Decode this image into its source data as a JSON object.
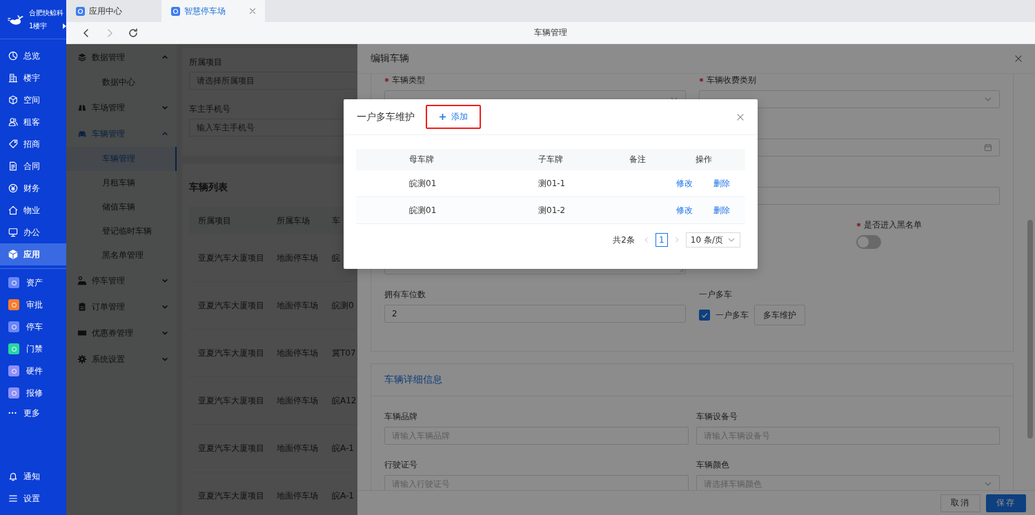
{
  "app": {
    "company": "合肥快鲸科",
    "building": "1楼宇"
  },
  "nav": {
    "items": [
      {
        "label": "总览",
        "selected": false
      },
      {
        "label": "楼宇",
        "selected": false
      },
      {
        "label": "空间",
        "selected": false
      },
      {
        "label": "租客",
        "selected": false
      },
      {
        "label": "招商",
        "selected": false
      },
      {
        "label": "合同",
        "selected": false
      },
      {
        "label": "财务",
        "selected": false
      },
      {
        "label": "物业",
        "selected": false
      },
      {
        "label": "办公",
        "selected": false
      },
      {
        "label": "应用",
        "selected": true
      }
    ],
    "apps": [
      {
        "label": "资产",
        "color": "#6b86f7"
      },
      {
        "label": "审批",
        "color": "#fb7d2a"
      },
      {
        "label": "停车",
        "color": "#6b86f7"
      },
      {
        "label": "门禁",
        "color": "#26d6a3"
      },
      {
        "label": "硬件",
        "color": "#8f8ff7"
      },
      {
        "label": "报修",
        "color": "#8f8ff7"
      }
    ],
    "more": "更多",
    "bottom": [
      "通知",
      "设置"
    ]
  },
  "tabs": [
    {
      "label": "应用中心",
      "selected": false,
      "closable": false
    },
    {
      "label": "智慧停车场",
      "selected": true,
      "closable": true
    }
  ],
  "toolbar": {
    "title": "车辆管理",
    "buttons": [
      {
        "kind": "back",
        "disabled": false
      },
      {
        "kind": "forward",
        "disabled": true
      },
      {
        "kind": "reload",
        "disabled": false
      }
    ]
  },
  "submenu": [
    {
      "label": "数据管理",
      "expanded": true,
      "selected": false,
      "children": [
        {
          "label": "数据中心",
          "selected": false
        }
      ]
    },
    {
      "label": "车场管理",
      "expanded": false,
      "selected": false
    },
    {
      "label": "车辆管理",
      "expanded": true,
      "selected": true,
      "children": [
        {
          "label": "车辆管理",
          "selected": true
        },
        {
          "label": "月租车辆",
          "selected": false
        },
        {
          "label": "储值车辆",
          "selected": false
        },
        {
          "label": "登记临时车辆",
          "selected": false
        },
        {
          "label": "黑名单管理",
          "selected": false
        }
      ]
    },
    {
      "label": "停车管理",
      "expanded": false,
      "selected": false
    },
    {
      "label": "订单管理",
      "expanded": false,
      "selected": false
    },
    {
      "label": "优惠券管理",
      "expanded": false,
      "selected": false
    },
    {
      "label": "系统设置",
      "expanded": false,
      "selected": false
    }
  ],
  "filters": [
    {
      "label": "所属项目",
      "placeholder": "请选择所属项目"
    },
    {
      "label": "车主手机号",
      "placeholder": "输入车主手机号"
    }
  ],
  "vehicle_list": {
    "title": "车辆列表",
    "columns": [
      "所属项目",
      "所属车场",
      "车"
    ],
    "rows": [
      [
        "亚夏汽车大厦项目",
        "地面停车场",
        "皖"
      ],
      [
        "亚夏汽车大厦项目",
        "地面停车场",
        "皖测0"
      ],
      [
        "亚夏汽车大厦项目",
        "地面停车场",
        "冀T07"
      ],
      [
        "亚夏汽车大厦项目",
        "地面停车场",
        "皖A12"
      ],
      [
        "亚夏汽车大厦项目",
        "地面停车场",
        "皖A-1"
      ],
      [
        "亚夏汽车大厦项目",
        "地面停车场",
        "皖A-1"
      ]
    ]
  },
  "drawer": {
    "title": "编辑车辆",
    "fields": [
      {
        "kind": "select",
        "label": "车辆类型",
        "required": true
      },
      {
        "kind": "select",
        "label": "车辆收费类别",
        "required": true
      },
      {
        "kind": "covered"
      },
      {
        "kind": "date"
      },
      {
        "kind": "covered"
      },
      {
        "kind": "input"
      },
      {
        "kind": "textarea"
      },
      {
        "kind": "switch",
        "label": "是否进入黑名单",
        "required": true,
        "on": false
      },
      {
        "kind": "input",
        "label": "拥有车位数",
        "value": "2"
      },
      {
        "kind": "checkbox",
        "label": "一户多车",
        "option": "一户多车",
        "checked": true,
        "button": "多车维护"
      }
    ],
    "details": {
      "title": "车辆详细信息",
      "fields": [
        {
          "kind": "input",
          "label": "车辆品牌",
          "placeholder": "请输入车辆品牌"
        },
        {
          "kind": "input",
          "label": "车辆设备号",
          "placeholder": "请输入车辆设备号"
        },
        {
          "kind": "input",
          "label": "行驶证号",
          "placeholder": "请输入行驶证号"
        },
        {
          "kind": "select",
          "label": "车辆颜色",
          "placeholder": "请选择车辆颜色"
        }
      ]
    },
    "buttons": [
      {
        "label": "取消",
        "kind": "default"
      },
      {
        "label": "保存",
        "kind": "primary"
      }
    ]
  },
  "modal": {
    "title": "一户多车维护",
    "add": {
      "label": "添加",
      "highlighted": true
    },
    "columns": [
      "母车牌",
      "子车牌",
      "备注",
      "操作"
    ],
    "rows": [
      {
        "parent": "皖测01",
        "child": "测01-1",
        "actions": [
          "修改",
          "删除"
        ]
      },
      {
        "parent": "皖测01",
        "child": "测01-2",
        "actions": [
          "修改",
          "删除"
        ]
      }
    ],
    "pagination": {
      "total": "共2条",
      "pages": [
        {
          "label": "1",
          "selected": true
        }
      ],
      "page_size": "10 条/页"
    }
  }
}
